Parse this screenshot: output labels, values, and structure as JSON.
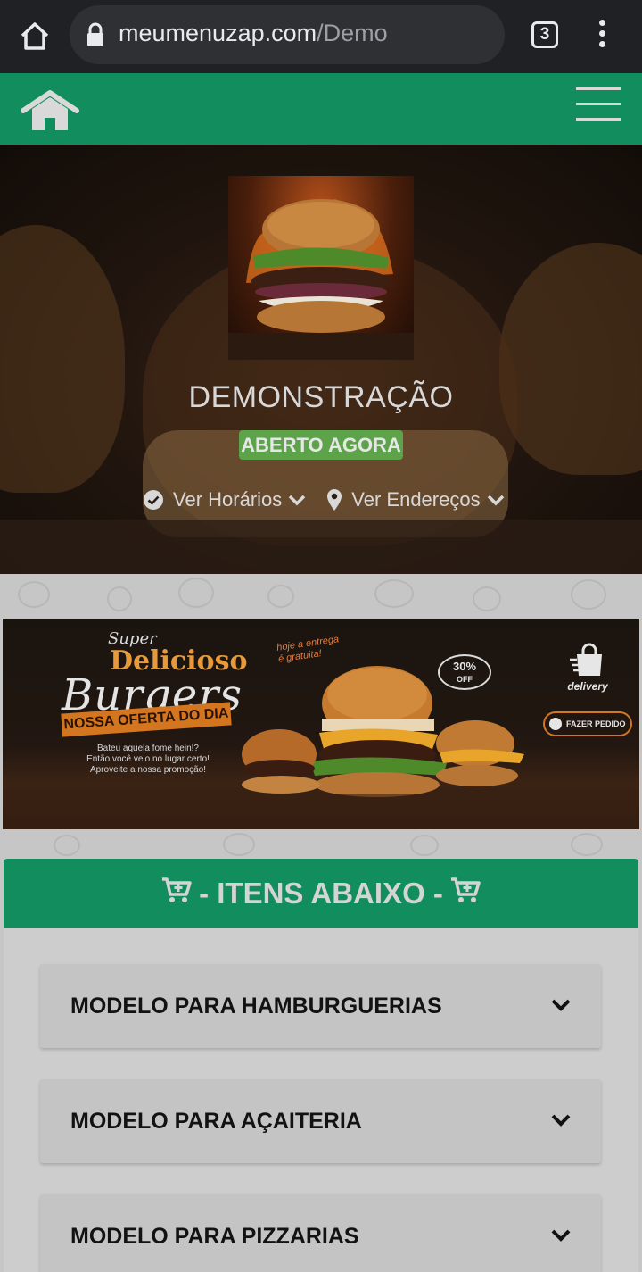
{
  "browser": {
    "url_domain": "meumenuzap.com",
    "url_path": "/Demo",
    "tab_count": "3"
  },
  "hero": {
    "store_name": "DEMONSTRAÇÃO",
    "status_badge": "ABERTO AGORA",
    "hours_link": "Ver Horários",
    "address_link": "Ver Endereços"
  },
  "banner": {
    "super": "Super",
    "delicioso": "Delicioso",
    "burgers": "Burgers",
    "oferta": "NOSSA OFERTA DO DIA",
    "promo_line1": "Bateu aquela fome hein!?",
    "promo_line2": "Então você veio no lugar certo!",
    "promo_line3": "Aproveite a nossa promoção!",
    "entrega_line1": "hoje a entrega",
    "entrega_line2": "é gratuita!",
    "discount": "30%",
    "discount_off": "OFF",
    "delivery": "delivery",
    "order_button": "FAZER PEDIDO"
  },
  "items": {
    "header": "- ITENS ABAIXO -",
    "categories": [
      {
        "label": "MODELO PARA HAMBURGUERIAS"
      },
      {
        "label": "MODELO PARA AÇAITERIA"
      },
      {
        "label": "MODELO PARA PIZZARIAS"
      }
    ]
  },
  "colors": {
    "brand_green": "#128e5e",
    "open_badge": "#5da34a",
    "browser_chrome": "#202124"
  },
  "icons": [
    "home-icon",
    "lock-icon",
    "tabs-icon",
    "more-vert-icon",
    "house-icon",
    "hamburger-menu-icon",
    "check-circle-icon",
    "chevron-down-icon",
    "map-pin-icon",
    "cart-icon"
  ]
}
